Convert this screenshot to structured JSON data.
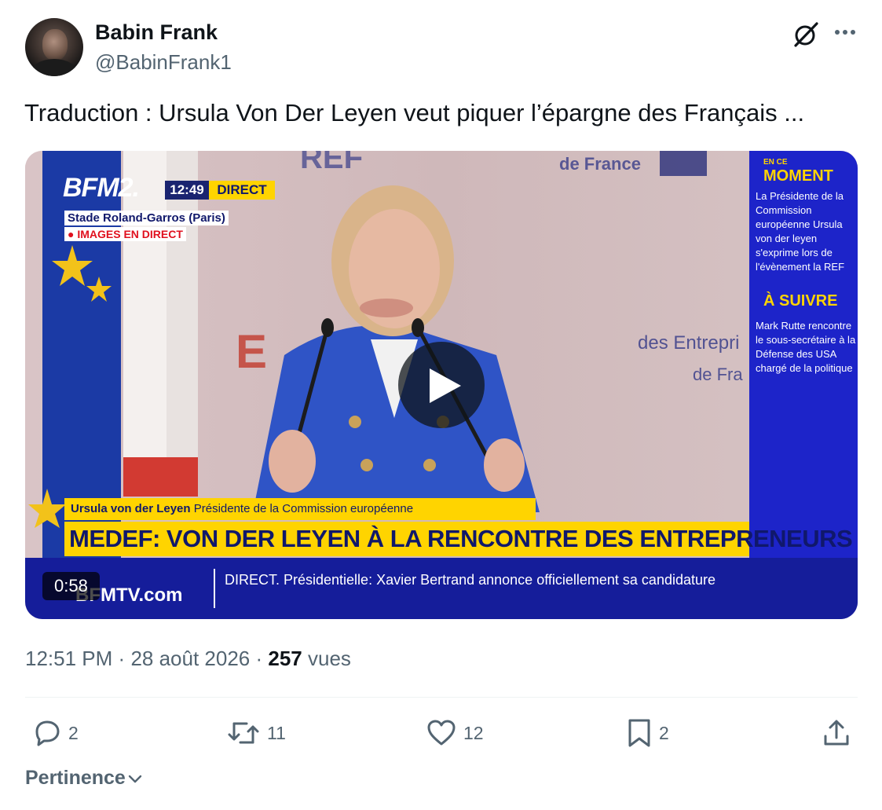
{
  "author": {
    "name": "Babin Frank",
    "handle": "@BabinFrank1"
  },
  "header_icons": [
    "grok-icon",
    "more-icon"
  ],
  "tweet": {
    "text": "Traduction : Ursula Von Der Leyen veut piquer l’épargne des Français ..."
  },
  "video": {
    "duration": "0:58",
    "overlay": {
      "channel_logo": "BFM2.",
      "clock": "12:49",
      "live_label": "DIRECT",
      "location": "Stade Roland-Garros (Paris)",
      "images_label": "● IMAGES EN DIRECT",
      "name_caption_name": "Ursula von der Leyen",
      "name_caption_role": "Présidente de la Commission européenne",
      "headline": "MEDEF: VON DER LEYEN À LA RENCONTRE DES ENTREPRENEURS",
      "ticker_site": "BFMTV.com",
      "ticker_text": "DIRECT. Présidentielle: Xavier Bertrand annonce officiellement sa candidature",
      "side_kicker": "EN CE",
      "side_head_1": "MOMENT",
      "side_body_1": "La Présidente de la Commission européenne Ursula von der leyen s'exprime lors de l'évènement la REF",
      "side_head_2": "À SUIVRE",
      "side_body_2": "Mark Rutte rencontre le sous-secrétaire à la Défense des USA chargé de la politique"
    }
  },
  "meta": {
    "time": "12:51 PM",
    "sep1": "·",
    "date": "28 août 2026",
    "sep2": "·",
    "views_count": "257",
    "views_label": "vues"
  },
  "actions": {
    "replies": "2",
    "reposts": "11",
    "likes": "12",
    "bookmarks": "2"
  },
  "sort": {
    "label": "Pertinence"
  },
  "colors": {
    "text_primary": "#0f1419",
    "text_secondary": "#536471",
    "divider": "#eff3f4",
    "bfm_yellow": "#ffd400",
    "bfm_blue": "#1d24c9"
  }
}
